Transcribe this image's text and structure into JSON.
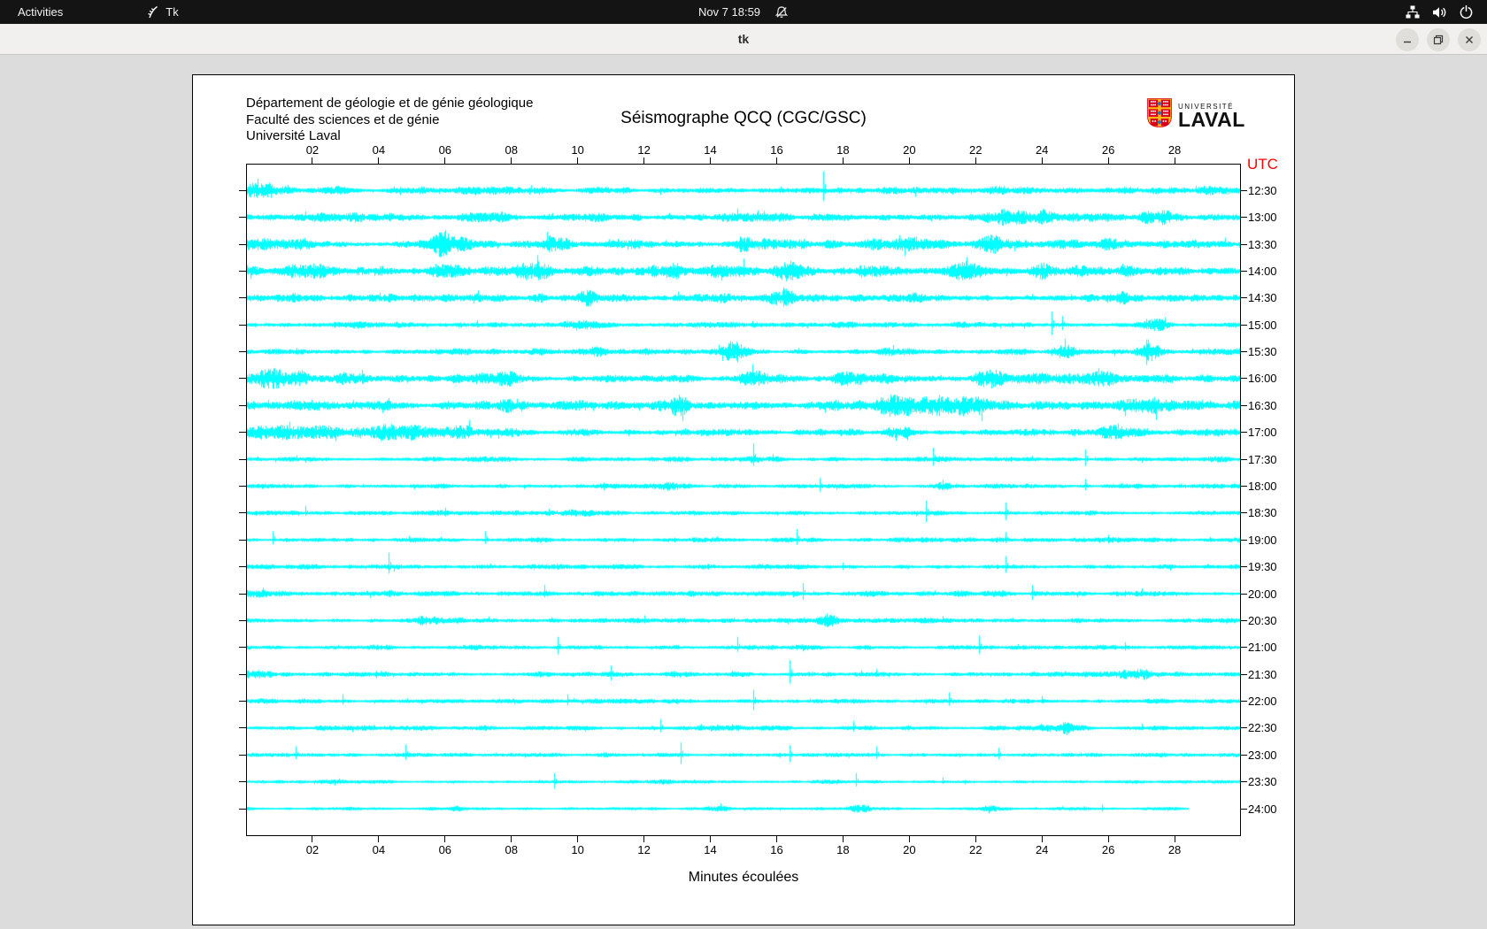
{
  "topbar": {
    "activities_label": "Activities",
    "app_menu_label": "Tk",
    "clock": "Nov 7 18:59"
  },
  "titlebar": {
    "title": "tk"
  },
  "seismograph": {
    "institution_lines": [
      "Département de géologie et de génie géologique",
      "Faculté des sciences et de génie",
      "Université Laval"
    ],
    "title": "Séismographe QCQ (CGC/GSC)",
    "logo": {
      "small": "UNIVERSITÉ",
      "large": "LAVAL"
    },
    "utc_label": "UTC",
    "xlabel": "Minutes écoulées",
    "x_tick_labels": [
      "02",
      "04",
      "06",
      "08",
      "10",
      "12",
      "14",
      "16",
      "18",
      "20",
      "22",
      "24",
      "26",
      "28"
    ],
    "axis_minutes_max": 30,
    "trace_color": "#00ffff",
    "utc_color": "#ff0000",
    "rows": [
      {
        "time": "12:30",
        "base": 3.2,
        "end": 30,
        "bursts": [
          [
            0.6,
            1.2,
            5
          ],
          [
            2.7,
            0.5,
            4
          ],
          [
            21,
            0.8,
            3
          ]
        ],
        "spikes": [
          [
            17.4,
            22
          ]
        ]
      },
      {
        "time": "13:00",
        "base": 3.4,
        "end": 30,
        "bursts": [
          [
            2.8,
            1.2,
            5
          ],
          [
            7.3,
            1.2,
            6
          ],
          [
            10.4,
            0.5,
            5
          ],
          [
            23.5,
            2.5,
            5
          ],
          [
            27.5,
            1,
            5
          ]
        ],
        "spikes": [
          [
            14.8,
            10
          ]
        ]
      },
      {
        "time": "13:30",
        "base": 3.8,
        "end": 30,
        "bursts": [
          [
            1,
            1.5,
            5
          ],
          [
            6,
            0.8,
            11
          ],
          [
            9.3,
            0.6,
            6
          ],
          [
            15,
            0.7,
            5
          ],
          [
            19.8,
            1.5,
            8
          ],
          [
            22.5,
            0.8,
            7
          ],
          [
            26,
            0.8,
            6
          ]
        ],
        "spikes": [
          [
            6,
            16
          ]
        ]
      },
      {
        "time": "14:00",
        "base": 4.2,
        "end": 30,
        "bursts": [
          [
            2,
            1,
            6
          ],
          [
            6,
            0.8,
            9
          ],
          [
            8.7,
            0.7,
            8
          ],
          [
            12.7,
            0.6,
            9
          ],
          [
            14.7,
            0.9,
            10
          ],
          [
            16.3,
            0.6,
            8
          ],
          [
            19,
            0.8,
            6
          ],
          [
            21.7,
            0.7,
            8
          ],
          [
            24,
            0.8,
            6
          ]
        ],
        "spikes": [
          [
            15,
            14
          ]
        ]
      },
      {
        "time": "14:30",
        "base": 3.2,
        "end": 30,
        "bursts": [
          [
            1.5,
            1,
            4
          ],
          [
            10.3,
            0.6,
            7
          ],
          [
            14.3,
            0.5,
            7
          ],
          [
            16.2,
            0.6,
            8
          ],
          [
            20,
            0.8,
            4
          ],
          [
            26.5,
            0.8,
            5
          ]
        ],
        "spikes": [
          [
            16.2,
            12
          ]
        ]
      },
      {
        "time": "15:00",
        "base": 2.4,
        "end": 30,
        "bursts": [
          [
            3,
            0.8,
            3
          ],
          [
            10,
            0.8,
            3
          ],
          [
            27.3,
            0.7,
            5
          ]
        ],
        "spikes": [
          [
            24.3,
            15
          ],
          [
            24.6,
            10
          ]
        ]
      },
      {
        "time": "15:30",
        "base": 2.8,
        "end": 30,
        "bursts": [
          [
            10.5,
            0.6,
            5
          ],
          [
            14.6,
            0.6,
            8
          ],
          [
            24.8,
            0.6,
            9
          ],
          [
            27.2,
            0.5,
            11
          ]
        ],
        "spikes": [
          [
            14.6,
            12
          ],
          [
            27.2,
            14
          ]
        ]
      },
      {
        "time": "16:00",
        "base": 4.2,
        "end": 30,
        "bursts": [
          [
            0.9,
            1.3,
            7
          ],
          [
            3.3,
            0.6,
            6
          ],
          [
            7.8,
            0.8,
            7
          ],
          [
            15.3,
            0.6,
            7
          ],
          [
            18,
            0.7,
            5
          ],
          [
            22.4,
            0.8,
            8
          ],
          [
            25.7,
            0.6,
            9
          ]
        ],
        "spikes": [
          [
            25.7,
            12
          ]
        ]
      },
      {
        "time": "16:30",
        "base": 4.2,
        "end": 30,
        "bursts": [
          [
            2,
            1,
            5
          ],
          [
            8,
            0.8,
            5
          ],
          [
            13,
            0.7,
            7
          ],
          [
            19.5,
            1.4,
            9
          ],
          [
            21.5,
            1.6,
            10
          ],
          [
            27.3,
            0.9,
            10
          ]
        ],
        "spikes": []
      },
      {
        "time": "17:00",
        "base": 3.2,
        "end": 30,
        "bursts": [
          [
            0.5,
            1,
            8
          ],
          [
            2,
            1.6,
            8
          ],
          [
            4.5,
            1.6,
            7
          ],
          [
            6.5,
            0.8,
            6
          ],
          [
            19.7,
            0.7,
            5
          ],
          [
            26.3,
            0.7,
            6
          ]
        ],
        "spikes": [
          [
            1.3,
            12
          ],
          [
            26.3,
            10
          ]
        ]
      },
      {
        "time": "17:30",
        "base": 1.9,
        "end": 30,
        "bursts": [
          [
            5.5,
            0.8,
            2
          ],
          [
            15.3,
            0.3,
            4
          ]
        ],
        "spikes": [
          [
            15.3,
            18
          ],
          [
            20.7,
            13
          ],
          [
            25.3,
            11
          ]
        ]
      },
      {
        "time": "18:00",
        "base": 1.9,
        "end": 30,
        "bursts": [
          [
            12.6,
            0.9,
            4
          ],
          [
            21,
            0.4,
            3
          ]
        ],
        "spikes": [
          [
            17.3,
            9
          ],
          [
            21,
            7
          ],
          [
            25.3,
            8
          ]
        ]
      },
      {
        "time": "18:30",
        "base": 1.9,
        "end": 30,
        "bursts": [
          [
            10,
            0.8,
            2
          ]
        ],
        "spikes": [
          [
            1.8,
            8
          ],
          [
            6,
            6
          ],
          [
            20.5,
            14
          ],
          [
            22.9,
            12
          ]
        ]
      },
      {
        "time": "19:00",
        "base": 1.9,
        "end": 30,
        "bursts": [],
        "spikes": [
          [
            0.8,
            10
          ],
          [
            7.2,
            10
          ],
          [
            16.6,
            12
          ],
          [
            22.9,
            9
          ],
          [
            26,
            6
          ]
        ]
      },
      {
        "time": "19:30",
        "base": 2.0,
        "end": 30,
        "bursts": [
          [
            11,
            0.6,
            3
          ]
        ],
        "spikes": [
          [
            4.3,
            16
          ],
          [
            18,
            5
          ],
          [
            22.9,
            12
          ]
        ]
      },
      {
        "time": "20:00",
        "base": 2.1,
        "end": 30,
        "bursts": [
          [
            0.3,
            0.8,
            4
          ]
        ],
        "spikes": [
          [
            9,
            10
          ],
          [
            16.8,
            12
          ],
          [
            23.7,
            10
          ],
          [
            27,
            6
          ]
        ]
      },
      {
        "time": "20:30",
        "base": 1.9,
        "end": 30,
        "bursts": [
          [
            5.6,
            0.8,
            5
          ],
          [
            17.5,
            0.5,
            6
          ]
        ],
        "spikes": [
          [
            12,
            6
          ],
          [
            17.5,
            8
          ],
          [
            21,
            5
          ]
        ]
      },
      {
        "time": "21:00",
        "base": 1.9,
        "end": 30,
        "bursts": [],
        "spikes": [
          [
            9.4,
            12
          ],
          [
            14.8,
            12
          ],
          [
            22.1,
            13
          ],
          [
            26.5,
            6
          ]
        ]
      },
      {
        "time": "21:30",
        "base": 2.1,
        "end": 30,
        "bursts": [
          [
            0.2,
            0.6,
            5
          ],
          [
            26.8,
            0.9,
            4
          ]
        ],
        "spikes": [
          [
            11,
            10
          ],
          [
            16.4,
            16
          ],
          [
            19,
            6
          ]
        ]
      },
      {
        "time": "22:00",
        "base": 1.9,
        "end": 30,
        "bursts": [],
        "spikes": [
          [
            2.9,
            8
          ],
          [
            9.7,
            8
          ],
          [
            15.3,
            13
          ],
          [
            21.2,
            10
          ],
          [
            24,
            6
          ]
        ]
      },
      {
        "time": "22:30",
        "base": 1.9,
        "end": 30,
        "bursts": [
          [
            24.6,
            0.7,
            5
          ]
        ],
        "spikes": [
          [
            12.5,
            10
          ],
          [
            18.3,
            8
          ],
          [
            27,
            5
          ]
        ]
      },
      {
        "time": "23:00",
        "base": 1.7,
        "end": 30,
        "bursts": [],
        "spikes": [
          [
            1.5,
            10
          ],
          [
            4.8,
            12
          ],
          [
            13.1,
            14
          ],
          [
            16.4,
            11
          ],
          [
            19,
            10
          ],
          [
            22.7,
            8
          ]
        ]
      },
      {
        "time": "23:30",
        "base": 1.4,
        "end": 30,
        "bursts": [],
        "spikes": [
          [
            9.3,
            10
          ],
          [
            18.4,
            10
          ],
          [
            21,
            5
          ]
        ]
      },
      {
        "time": "24:00",
        "base": 1.1,
        "end": 28.4,
        "bursts": [
          [
            6.4,
            0.4,
            3
          ],
          [
            14.3,
            0.4,
            3
          ],
          [
            18.5,
            0.4,
            4
          ],
          [
            22.4,
            0.4,
            3
          ]
        ],
        "spikes": [
          [
            25.8,
            5
          ]
        ]
      }
    ]
  }
}
